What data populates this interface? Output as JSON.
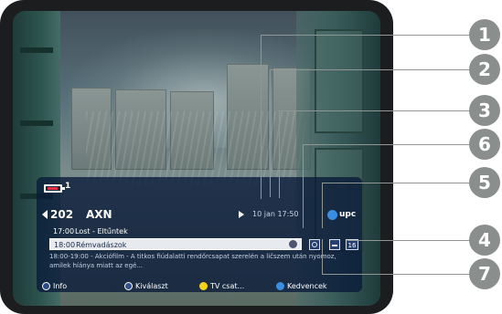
{
  "osd": {
    "status_number": "1",
    "channel_number": "202",
    "channel_name": "AXN",
    "datetime": "10 jan 17:50",
    "provider_logo_text": "upc",
    "programmes": [
      {
        "time": "17:00",
        "title": "Lost - Eltűntek"
      },
      {
        "time": "18:00",
        "title": "Rémvadászok"
      }
    ],
    "age_rating": "16",
    "description": "18:00-19:00 - Akciófilm - A titkos fiúdalatti rendőrcsapat szerelén a ličszem után nyomoz, amilek híánya miatt az egé...",
    "hints": {
      "info": "Info",
      "select": "Kiválaszt",
      "tv_channels": "TV csat...",
      "favourites": "Kedvencek"
    }
  },
  "callouts": [
    "1",
    "2",
    "3",
    "6",
    "5",
    "4",
    "7"
  ],
  "colors": {
    "osd_background": "#0a1c3a",
    "badge": "#8a8e8d",
    "highlight_row": "#e7eaee",
    "yellow_key": "#f4d21a",
    "blue_key": "#3b8fe0"
  }
}
